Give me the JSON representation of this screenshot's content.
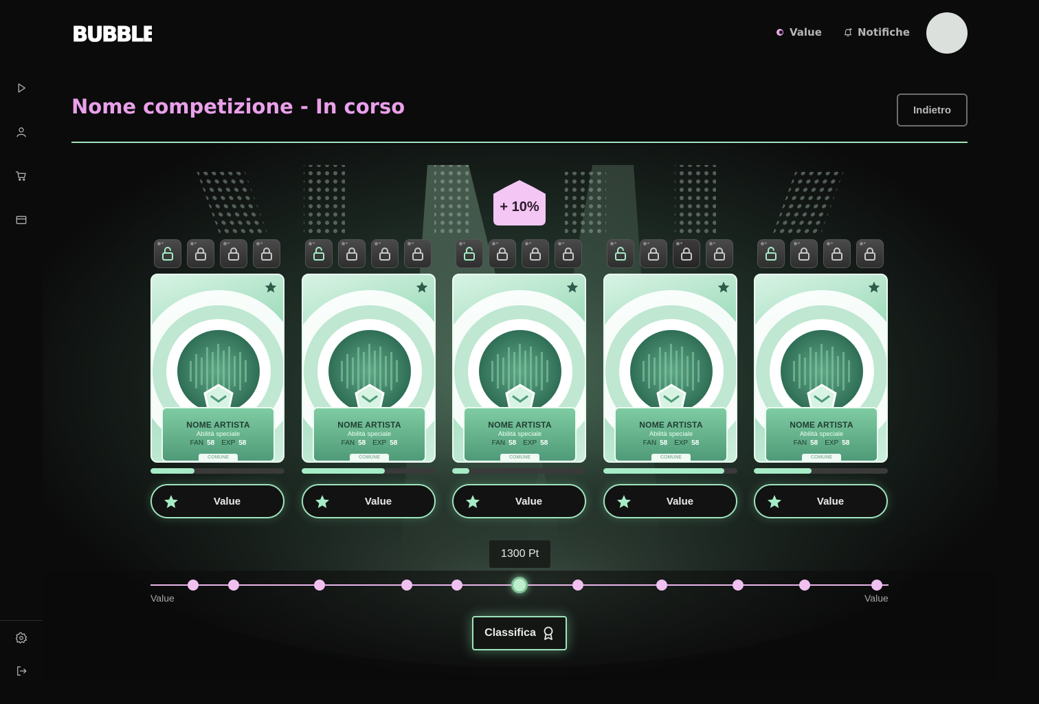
{
  "header": {
    "logo_text": "BUBBLE",
    "nav": [
      {
        "label": "Value",
        "icon": "token-icon"
      },
      {
        "label": "Notifiche",
        "icon": "bell-icon"
      }
    ]
  },
  "sidebar": {
    "items": [
      {
        "name": "play",
        "icon": "play-icon"
      },
      {
        "name": "profile",
        "icon": "user-icon"
      },
      {
        "name": "shop",
        "icon": "cart-icon"
      },
      {
        "name": "wallet",
        "icon": "card-icon"
      }
    ],
    "bottom": [
      {
        "name": "settings",
        "icon": "gear-icon"
      },
      {
        "name": "logout",
        "icon": "logout-icon"
      }
    ]
  },
  "page": {
    "title": "Nome competizione - In corso",
    "back_label": "Indietro"
  },
  "boost": {
    "label": "+ 10%"
  },
  "cards": [
    {
      "artist": "NOME ARTISTA",
      "skill": "Abilità speciale",
      "fan_label": "FAN",
      "fan": "58",
      "exp_label": "EXP",
      "exp": "58",
      "rarity": "COMUNE",
      "progress": 0.33,
      "button": "Value",
      "locks_unlocked": 1
    },
    {
      "artist": "NOME ARTISTA",
      "skill": "Abilità speciale",
      "fan_label": "FAN",
      "fan": "58",
      "exp_label": "EXP",
      "exp": "58",
      "rarity": "COMUNE",
      "progress": 0.62,
      "button": "Value",
      "locks_unlocked": 1
    },
    {
      "artist": "NOME ARTISTA",
      "skill": "Abilità speciale",
      "fan_label": "FAN",
      "fan": "58",
      "exp_label": "EXP",
      "exp": "58",
      "rarity": "COMUNE",
      "progress": 0.13,
      "button": "Value",
      "locks_unlocked": 1
    },
    {
      "artist": "NOME ARTISTA",
      "skill": "Abilità speciale",
      "fan_label": "FAN",
      "fan": "58",
      "exp_label": "EXP",
      "exp": "58",
      "rarity": "COMUNE",
      "progress": 0.9,
      "button": "Value",
      "locks_unlocked": 1
    },
    {
      "artist": "NOME ARTISTA",
      "skill": "Abilità speciale",
      "fan_label": "FAN",
      "fan": "58",
      "exp_label": "EXP",
      "exp": "58",
      "rarity": "COMUNE",
      "progress": 0.43,
      "button": "Value",
      "locks_unlocked": 1
    }
  ],
  "points": {
    "current_label": "1300 Pt",
    "min_label": "Value",
    "max_label": "Value",
    "milestones": 11,
    "active_index": 5
  },
  "ranking": {
    "label": "Classifica"
  },
  "colors": {
    "accent_green": "#9fe5bd",
    "title_pink": "#eaa0ea",
    "background": "#0b0b0b"
  }
}
